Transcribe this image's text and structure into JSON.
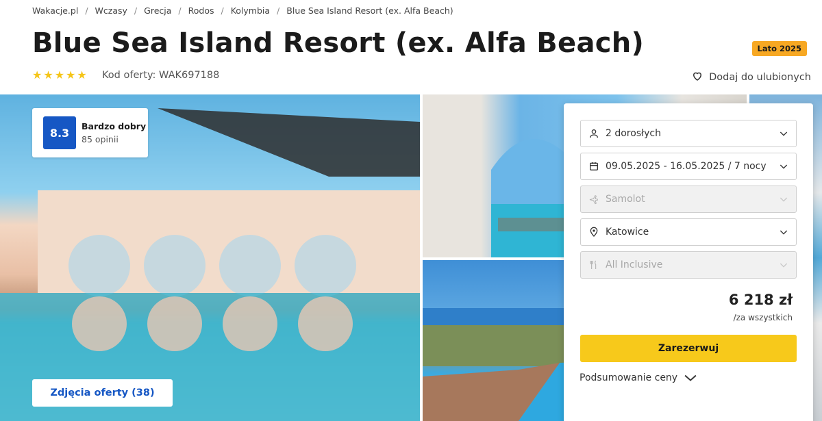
{
  "breadcrumb": [
    "Wakacje.pl",
    "Wczasy",
    "Grecja",
    "Rodos",
    "Kolymbia",
    "Blue Sea Island Resort (ex. Alfa Beach)"
  ],
  "title": "Blue Sea Island Resort (ex. Alfa Beach)",
  "season_badge": "Lato 2025",
  "stars": 5,
  "offer_code": "Kod oferty: WAK697188",
  "favorite_label": "Dodaj do ulubionych",
  "rating": {
    "score": "8.3",
    "label": "Bardzo dobry",
    "count": "85 opinii"
  },
  "photos_button": "Zdjęcia oferty (38)",
  "booking": {
    "travelers": "2 dorosłych",
    "dates": "09.05.2025 - 16.05.2025 / 7 nocy",
    "transport": "Samolot",
    "departure": "Katowice",
    "board": "All Inclusive",
    "price": "6 218 zł",
    "price_note": "/za wszystkich",
    "book_button": "Zarezerwuj",
    "summary_label": "Podsumowanie ceny"
  },
  "colors": {
    "accent_blue": "#1657c4",
    "book_yellow": "#f7c91b",
    "badge_orange": "#f7a823",
    "star": "#f5c518"
  },
  "icons": [
    "heart-icon",
    "person-icon",
    "calendar-icon",
    "plane-icon",
    "location-pin-icon",
    "cutlery-icon",
    "chevron-down-icon",
    "star-icon"
  ]
}
